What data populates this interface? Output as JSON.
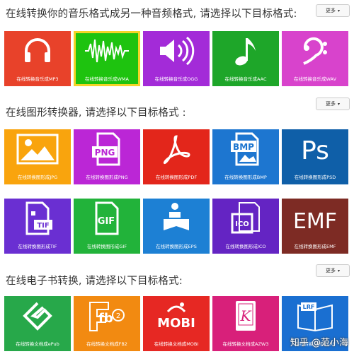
{
  "audio": {
    "title": "在线转换你的音乐格式成另一种音频格式, 请选择以下目标格式:",
    "more_label": "更多",
    "tiles": [
      {
        "label": "在线转换音乐成MP3",
        "icon": "headphones-icon",
        "color": "#e8422a"
      },
      {
        "label": "在线转换音乐成WMA",
        "icon": "waveform-icon",
        "color": "#1ec30f",
        "selected": true
      },
      {
        "label": "在线转换音乐成OGG",
        "icon": "speaker-icon",
        "color": "#a32bd8"
      },
      {
        "label": "在线转换音乐成AAC",
        "icon": "music-note-icon",
        "color": "#1ea629"
      },
      {
        "label": "在线转换音乐成WAV",
        "icon": "bass-clef-icon",
        "color": "#d843cc"
      }
    ]
  },
  "image": {
    "title": "在线图形转换器, 请选择以下目标格式 :",
    "more_label": "更多",
    "tiles": [
      {
        "label": "在线转换图形成JPG",
        "icon": "picture-icon",
        "color": "#f9a40d"
      },
      {
        "label": "在线转换图形成PNG",
        "icon": "png-file-icon",
        "color": "#bb26d6"
      },
      {
        "label": "在线转换图形成PDF",
        "icon": "acrobat-icon",
        "color": "#e3261b"
      },
      {
        "label": "在线转换图形成BMP",
        "icon": "bmp-file-icon",
        "color": "#1d76d0"
      },
      {
        "label": "在线转换图形成PSD",
        "icon": "photoshop-icon",
        "color": "#0f5fa8"
      },
      {
        "label": "在线转换图形成TIF",
        "icon": "tif-file-icon",
        "color": "#6a2fd2"
      },
      {
        "label": "在线转换图形成GIF",
        "icon": "gif-file-icon",
        "color": "#22b33a"
      },
      {
        "label": "在线转换图形成EPS",
        "icon": "eps-reader-icon",
        "color": "#1d80d4"
      },
      {
        "label": "在线转换图形成ICO",
        "icon": "ico-file-icon",
        "color": "#6424c3"
      },
      {
        "label": "在线转换图形成EMF",
        "icon": "emf-text-icon",
        "color": "#7d2b24"
      }
    ]
  },
  "ebook": {
    "title": "在线电子书转换, 请选择以下目标格式:",
    "more_label": "更多",
    "tiles": [
      {
        "label": "在线转换文档成ePub",
        "icon": "epub-icon",
        "color": "#27a84a",
        "glyph": ""
      },
      {
        "label": "在线转换文档成FB2",
        "icon": "fb2-icon",
        "color": "#f28a11",
        "glyph": "fb"
      },
      {
        "label": "在线转换文档成MOBI",
        "icon": "mobi-icon",
        "color": "#e62823",
        "glyph": "MOBI"
      },
      {
        "label": "在线转换文档成AZW3",
        "icon": "kindle-icon",
        "color": "#d8207a",
        "glyph": "K"
      },
      {
        "label": "在线转换文档成LRF",
        "icon": "lrf-book-icon",
        "color": "#1a6fd1",
        "glyph": "LRF"
      }
    ]
  },
  "watermark": "知乎 @范小海"
}
